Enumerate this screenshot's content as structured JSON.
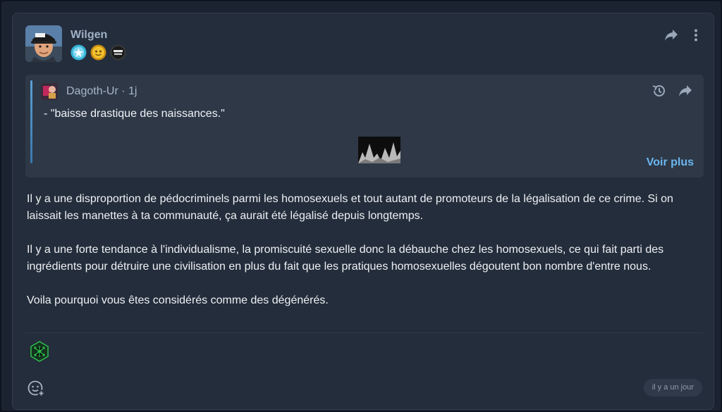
{
  "post": {
    "author": "Wilgen",
    "badges": [
      "badge-blue-star",
      "badge-gold-face",
      "badge-zero-tout"
    ],
    "quote": {
      "author_line": "Dagoth-Ur · 1j",
      "text": "- \"baisse drastique des naissances.\"",
      "more_label": "Voir plus"
    },
    "body": [
      "Il y a une disproportion de pédocriminels parmi les homosexuels et tout autant de promoteurs de la légalisation de ce crime. Si on laissait les manettes à ta communauté, ça aurait été légalisé depuis longtemps.",
      "Il y a une forte tendance à l'individualisme, la promiscuité sexuelle donc la débauche chez les homosexuels, ce qui fait parti des ingrédients pour détruire une civilisation en plus du fait que les pratiques homosexuelles dégoutent bon nombre d'entre nous.",
      "Voila pourquoi vous êtes considérés comme des dégénérés."
    ],
    "timestamp": "il y a un jour"
  },
  "colors": {
    "card_bg": "#242d3b",
    "quote_bg": "#2e3847",
    "accent_link": "#6bb6ef",
    "username": "#9fb0c5",
    "reaction_green": "#2fbf4f"
  },
  "icons": {
    "share": "share-arrow-icon",
    "menu": "vertical-dots-icon",
    "history": "history-icon",
    "reaction": "green-network-hex-icon",
    "emoji": "add-emoji-icon"
  }
}
